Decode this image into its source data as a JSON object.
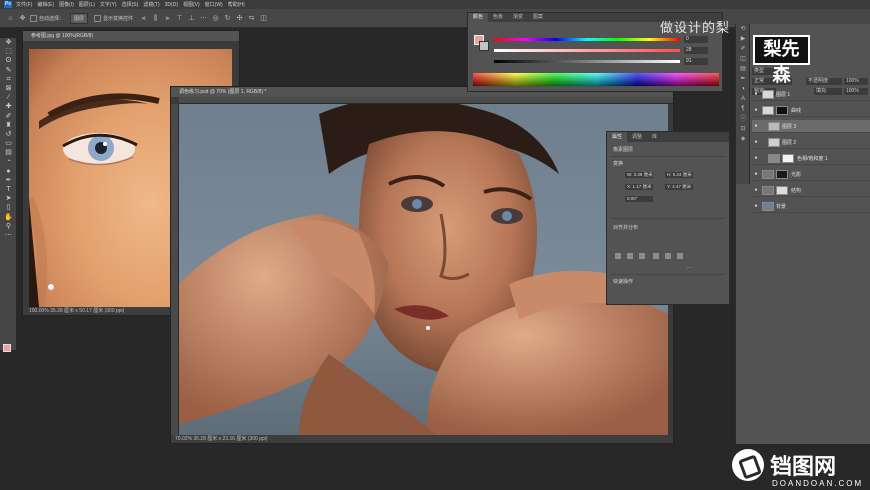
{
  "menubar": {
    "app_logo": "Ps",
    "items": [
      "文件(F)",
      "编辑(E)",
      "图像(I)",
      "图层(L)",
      "文字(Y)",
      "选择(S)",
      "滤镜(T)",
      "3D(D)",
      "视图(V)",
      "窗口(W)",
      "帮助(H)"
    ]
  },
  "options_bar": {
    "auto_select_label": "自动选择：",
    "auto_select_value": "图层",
    "show_transform_label": "显示变换控件"
  },
  "doc1": {
    "tab_title": "参考图.jpg @ 100%(RGB/8)",
    "status": "100.00%  35.28 厘米 x 50.17 厘米 (300 ppi)"
  },
  "doc2": {
    "tab_title": "调色练习.psd @ 70% (图层 1, RGB/8) *",
    "status": "70.02%  36.28 厘米 x 23.16 厘米 (300 ppi)"
  },
  "color_panel": {
    "tabs": [
      "颜色",
      "色板",
      "渐变",
      "图案"
    ],
    "values": [
      "0",
      "28",
      "91"
    ]
  },
  "properties_panel": {
    "tabs": [
      "属性",
      "调整",
      "库"
    ],
    "section_title": "像素图层",
    "transform_label": "变换",
    "w_field": "W: 3.38 厘米",
    "h_field": "H: 5.24 厘米",
    "x_field": "X: 1.17 厘米",
    "y_field": "Y: 4.47 厘米",
    "angle_field": "0.00°",
    "align_label": "对齐并分布",
    "quick_label": "快速操作",
    "more": "..."
  },
  "layers_panel": {
    "kind_label": "类型",
    "blend_mode": "正常",
    "opacity_label": "不透明度:",
    "opacity_value": "100%",
    "fill_label": "填充:",
    "fill_value": "100%",
    "lock_label": "锁定:",
    "layers": [
      {
        "name": "图层 1",
        "selected": false,
        "thumb": "#d8d8d8",
        "indent": 0
      },
      {
        "name": "曲线",
        "selected": false,
        "thumb": "#111111",
        "indent": 0
      },
      {
        "name": "图层 3",
        "selected": true,
        "thumb": "#b9b9b9",
        "indent": 8
      },
      {
        "name": "图层 2",
        "selected": false,
        "thumb": "#cfcfcf",
        "indent": 8
      },
      {
        "name": "色相/饱和度 1",
        "selected": false,
        "thumb": "#f2f2f2",
        "indent": 8
      },
      {
        "name": "光影",
        "selected": false,
        "thumb": "#1a1a1a",
        "indent": 0
      },
      {
        "name": "结构",
        "selected": false,
        "thumb": "#dddddd",
        "indent": 0
      },
      {
        "name": "背景",
        "selected": false,
        "thumb": "#6f7f8e",
        "indent": 0
      }
    ]
  },
  "watermark": {
    "top_text": "做设计的梨",
    "logo_text": "梨先森",
    "site_name_cn": "铛图网",
    "site_name_en": "DOANDOAN.COM"
  },
  "colors": {
    "fg_color": "#e8a49a",
    "bg_color": "#c4c4c4"
  }
}
